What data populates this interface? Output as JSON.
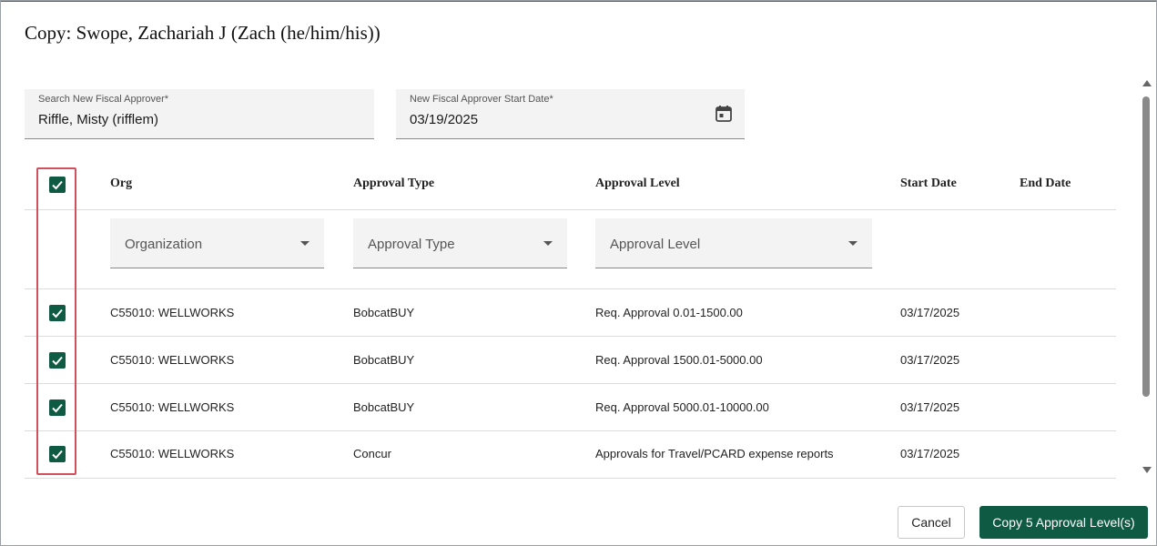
{
  "dialog": {
    "title": "Copy: Swope, Zachariah J (Zach (he/him/his))"
  },
  "form": {
    "search_label": "Search New Fiscal Approver*",
    "search_value": "Riffle, Misty (rifflem)",
    "date_label": "New Fiscal Approver Start Date*",
    "date_value": "03/19/2025",
    "date_icon": "calendar-icon"
  },
  "table": {
    "headers": {
      "org": "Org",
      "approval_type": "Approval Type",
      "approval_level": "Approval Level",
      "start_date": "Start Date",
      "end_date": "End Date"
    },
    "filters": {
      "org": "Organization",
      "approval_type": "Approval Type",
      "approval_level": "Approval Level"
    },
    "select_all_checked": true,
    "rows": [
      {
        "checked": true,
        "org": "C55010: WELLWORKS",
        "approval_type": "BobcatBUY",
        "approval_level": "Req. Approval 0.01-1500.00",
        "start_date": "03/17/2025",
        "end_date": ""
      },
      {
        "checked": true,
        "org": "C55010: WELLWORKS",
        "approval_type": "BobcatBUY",
        "approval_level": "Req. Approval 1500.01-5000.00",
        "start_date": "03/17/2025",
        "end_date": ""
      },
      {
        "checked": true,
        "org": "C55010: WELLWORKS",
        "approval_type": "BobcatBUY",
        "approval_level": "Req. Approval 5000.01-10000.00",
        "start_date": "03/17/2025",
        "end_date": ""
      },
      {
        "checked": true,
        "org": "C55010: WELLWORKS",
        "approval_type": "Concur",
        "approval_level": "Approvals for Travel/PCARD expense reports",
        "start_date": "03/17/2025",
        "end_date": ""
      }
    ]
  },
  "actions": {
    "cancel": "Cancel",
    "copy": "Copy 5 Approval Level(s)"
  },
  "colors": {
    "brand": "#0e5a43",
    "highlight": "#d0505e"
  }
}
